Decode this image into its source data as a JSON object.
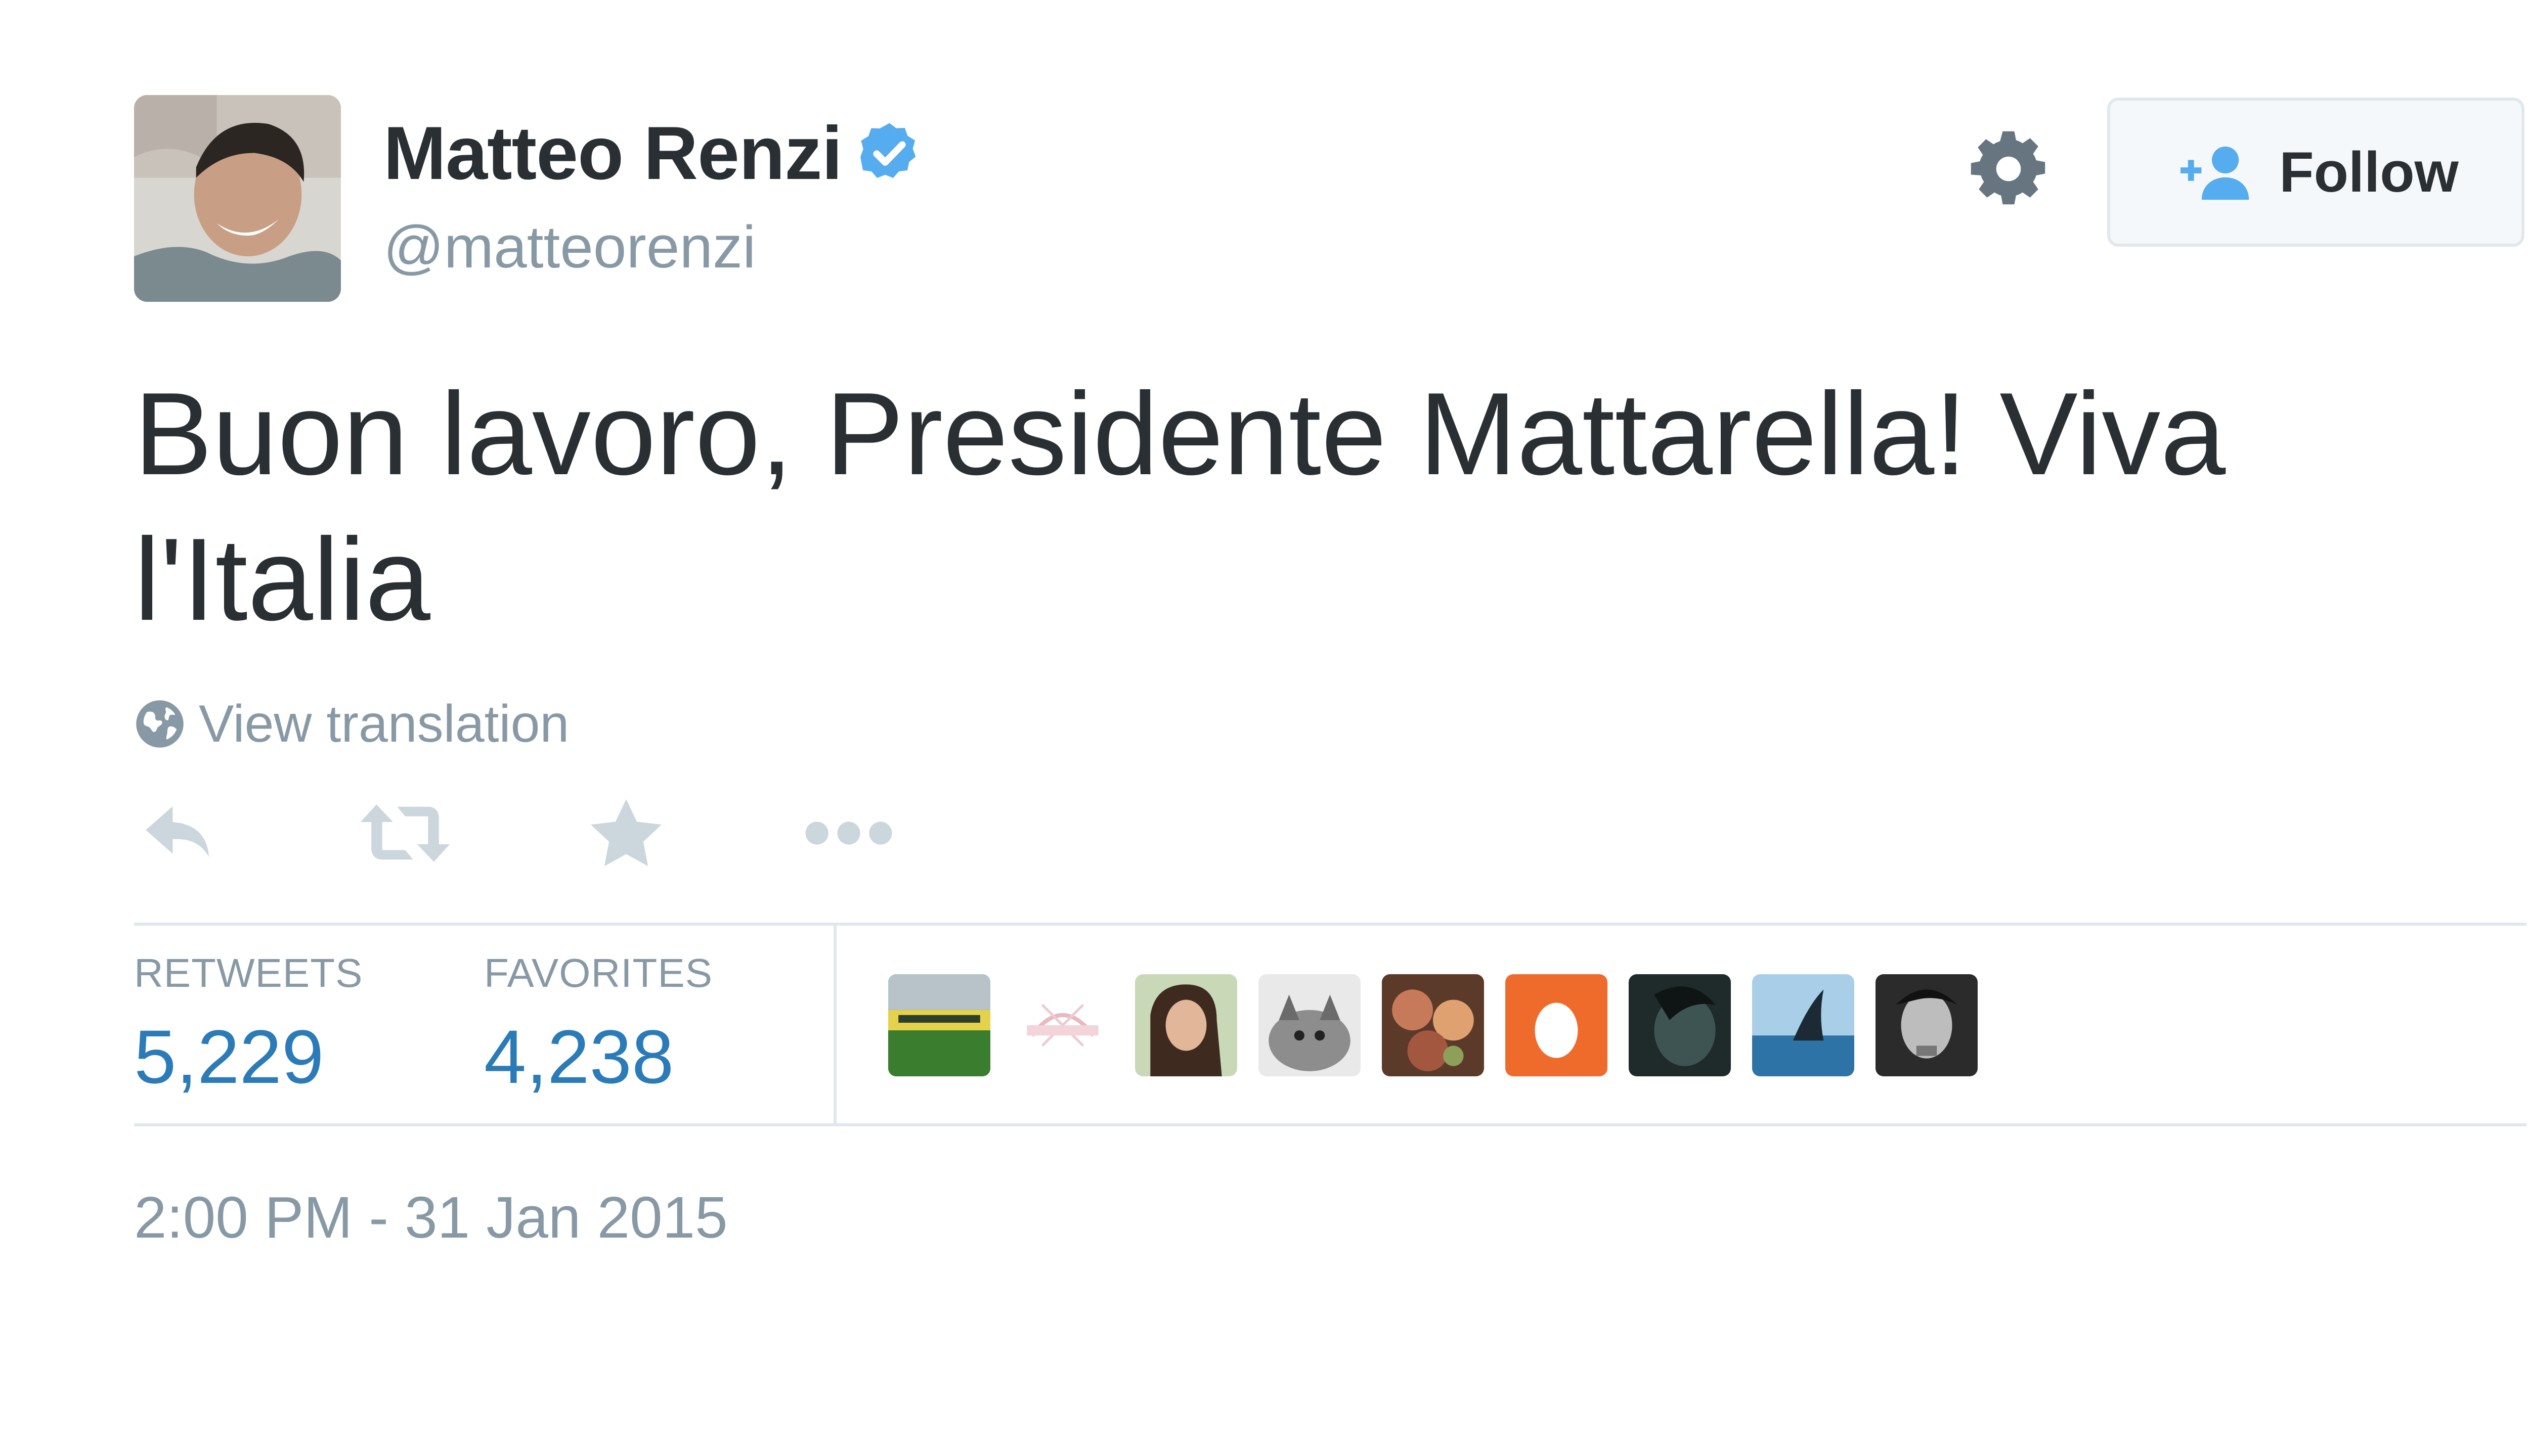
{
  "author": {
    "name": "Matteo Renzi",
    "handle": "@matteorenzi",
    "verified": true,
    "avatar_icon": "profile-photo"
  },
  "actions": {
    "settings_icon": "gear-icon",
    "follow_label": "Follow",
    "follow_icon": "add-user-icon"
  },
  "tweet": {
    "text": "Buon lavoro, Presidente Mattarella! Viva l'Italia",
    "translation_link": "View translation",
    "timestamp": "2:00 PM - 31 Jan 2015"
  },
  "tweet_actions": [
    "reply-icon",
    "retweet-icon",
    "favorite-icon",
    "more-icon"
  ],
  "stats": {
    "retweets_label": "RETWEETS",
    "retweets_count": "5,229",
    "favorites_label": "FAVORITES",
    "favorites_count": "4,238"
  },
  "favorited_by": [
    "team-photo-avatar",
    "logo-avatar",
    "woman-portrait-avatar",
    "cat-avatar",
    "flowers-avatar",
    "default-egg-avatar",
    "dark-portrait-avatar",
    "shark-fin-avatar",
    "man-portrait-avatar"
  ],
  "colors": {
    "text": "#292f33",
    "muted": "#8899a6",
    "link": "#2b7bb9",
    "verified": "#55acee",
    "border": "#e1e8ed",
    "button_bg": "#f5f8fa"
  }
}
